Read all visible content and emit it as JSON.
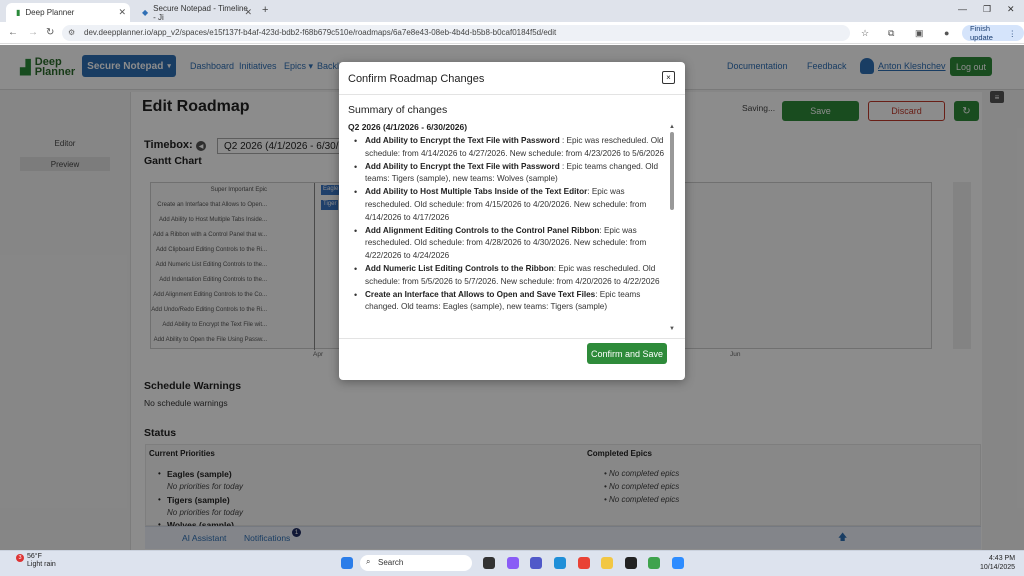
{
  "browser": {
    "tabs": [
      {
        "title": "Deep Planner",
        "active": true
      },
      {
        "title": "Secure Notepad - Timeline - Ji",
        "active": false
      }
    ],
    "url": "dev.deepplanner.io/app_v2/spaces/e15f137f-b4af-423d-bdb2-f68b679c510e/roadmaps/6a7e8e43-08eb-4b4d-b5b8-b0caf0184f5d/edit",
    "finish_update": "Finish update"
  },
  "header": {
    "logo_line1": "Deep",
    "logo_line2": "Planner",
    "project": "Secure Notepad",
    "nav": [
      "Dashboard",
      "Initiatives",
      "Epics",
      "Backl"
    ],
    "documentation": "Documentation",
    "feedback": "Feedback",
    "user": "Anton Kleshchev",
    "logout": "Log out"
  },
  "sidebar": {
    "items": [
      "Editor",
      "Preview"
    ]
  },
  "editor": {
    "title": "Edit Roadmap",
    "saving": "Saving...",
    "save": "Save",
    "discard": "Discard",
    "timebox_label": "Timebox:",
    "timebox_value": "Q2 2026 (4/1/2026 - 6/30/2026)",
    "gantt_title": "Gantt Chart",
    "gantt_rows": [
      "Super Important Epic",
      "Create an Interface that Allows to Open...",
      "Add Ability to Host Multiple Tabs Inside...",
      "Add a Ribbon with a Control Panel that w...",
      "Add Clipboard Editing Controls to the Ri...",
      "Add Numeric List Editing Controls to the...",
      "Add Indentation Editing Controls to the...",
      "Add Alignment Editing Controls to the Co...",
      "Add Undo/Redo Editing Controls to the Ri...",
      "Add Ability to Encrypt the Text File wit...",
      "Add Ability to Open the File Using Passw..."
    ],
    "gantt_bars": [
      "Eagle",
      "Tiger"
    ],
    "gantt_ticks": [
      "Apr",
      "Jun"
    ],
    "schedule_warnings_title": "Schedule Warnings",
    "schedule_warnings_text": "No schedule warnings",
    "status_title": "Status",
    "current_priorities": "Current Priorities",
    "completed_epics": "Completed Epics",
    "teams": [
      {
        "name": "Eagles (sample)",
        "sub": "No priorities for today"
      },
      {
        "name": "Tigers (sample)",
        "sub": "No priorities for today"
      },
      {
        "name": "Wolves (sample)",
        "sub": ""
      }
    ],
    "completed": [
      "No completed epics",
      "No completed epics",
      "No completed epics"
    ],
    "bottom": {
      "ai": "AI Assistant",
      "notifications": "Notifications",
      "notif_count": "1"
    }
  },
  "modal": {
    "title": "Confirm Roadmap Changes",
    "close": "×",
    "summary": "Summary of changes",
    "period": "Q2 2026 (4/1/2026 - 6/30/2026)",
    "changes": [
      {
        "epic": "Add Ability to Encrypt the Text File with Password",
        "detail": " : Epic was rescheduled. Old schedule: from 4/14/2026 to 4/27/2026. New schedule: from 4/23/2026 to 5/6/2026"
      },
      {
        "epic": "Add Ability to Encrypt the Text File with Password",
        "detail": " : Epic teams changed. Old teams: Tigers (sample), new teams: Wolves (sample)"
      },
      {
        "epic": "Add Ability to Host Multiple Tabs Inside of the Text Editor",
        "detail": ": Epic was rescheduled. Old schedule: from 4/15/2026 to 4/20/2026. New schedule: from 4/14/2026 to 4/17/2026"
      },
      {
        "epic": "Add Alignment Editing Controls to the Control Panel Ribbon",
        "detail": ": Epic was rescheduled. Old schedule: from 4/28/2026 to 4/30/2026. New schedule: from 4/22/2026 to 4/24/2026"
      },
      {
        "epic": "Add Numeric List Editing Controls to the Ribbon",
        "detail": ": Epic was rescheduled. Old schedule: from 5/5/2026 to 5/7/2026. New schedule: from 4/20/2026 to 4/22/2026"
      },
      {
        "epic": "Create an Interface that Allows to Open and Save Text Files",
        "detail": ": Epic teams changed. Old teams: Eagles (sample), new teams: Tigers (sample)"
      }
    ],
    "confirm": "Confirm and Save"
  },
  "taskbar": {
    "weather_temp": "56°F",
    "weather_desc": "Light rain",
    "weather_badge": "3",
    "search": "Search",
    "time": "4:43 PM",
    "date": "10/14/2025"
  },
  "colors": {
    "primary": "#2f6fb5",
    "success": "#2e8b3a",
    "danger": "#c0392b"
  }
}
